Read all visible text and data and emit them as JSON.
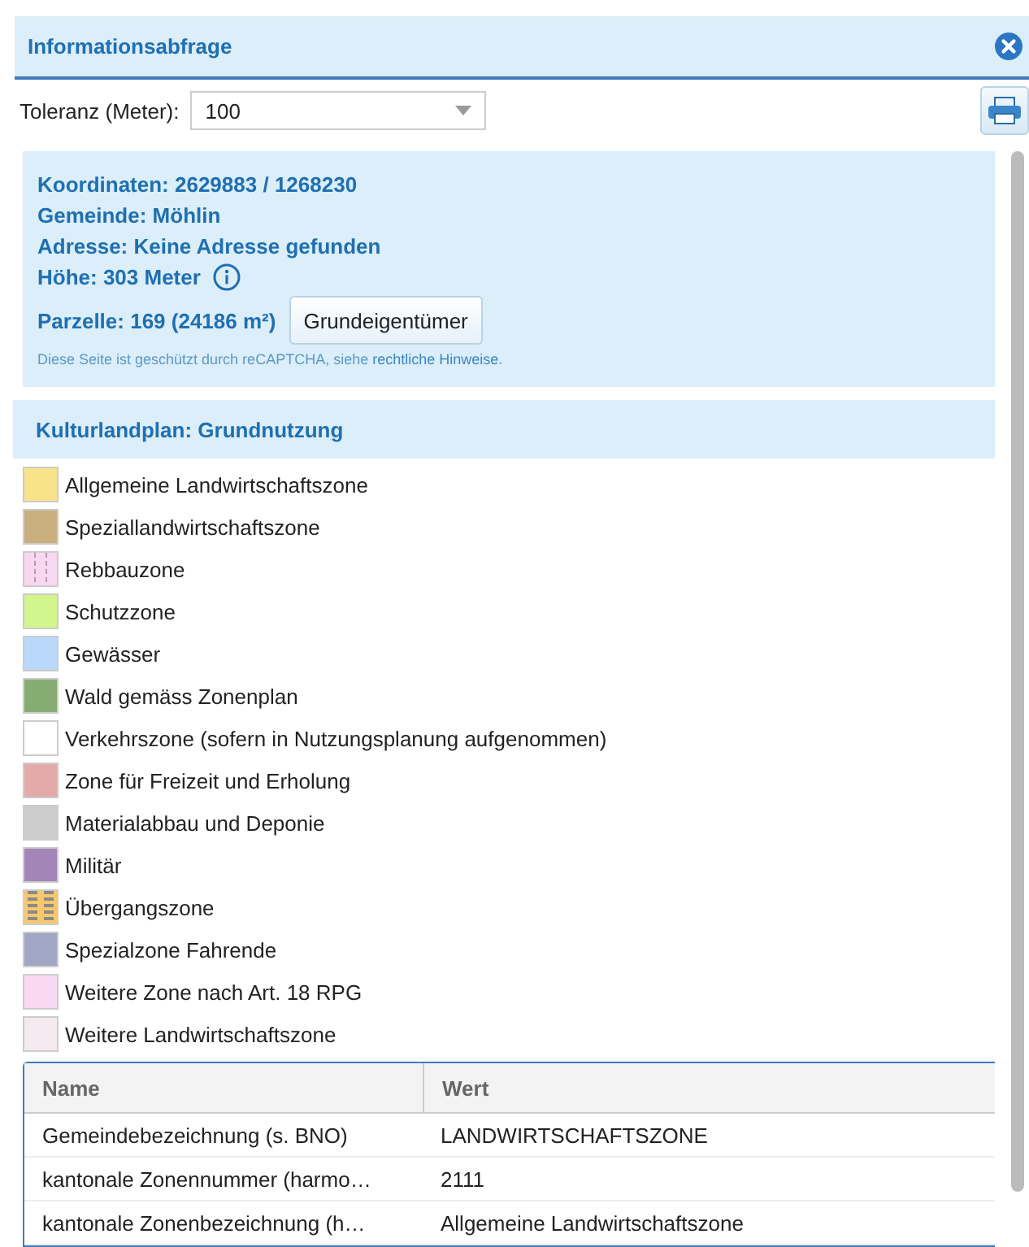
{
  "window": {
    "title": "Informationsabfrage"
  },
  "tolerance": {
    "label": "Toleranz (Meter):",
    "value": "100"
  },
  "info": {
    "lines": [
      {
        "kind": "text",
        "text": "Koordinaten: 2629883 / 1268230"
      },
      {
        "kind": "text",
        "text": "Gemeinde: Möhlin"
      },
      {
        "kind": "text",
        "text": "Adresse: Keine Adresse gefunden"
      },
      {
        "kind": "info",
        "text": "Höhe: 303 Meter"
      },
      {
        "kind": "button",
        "text": "Parzelle: 169 (24186 m²)",
        "button": "Grundeigentümer"
      }
    ],
    "notice": {
      "before": "Diese Seite ist geschützt durch reCAPTCHA, siehe ",
      "link": "rechtliche Hinweise",
      "after": "."
    }
  },
  "section": {
    "title": "Kulturlandplan: Grundnutzung"
  },
  "legend": [
    {
      "label": "Allgemeine Landwirtschaftszone",
      "kind": "solid",
      "color": "#f9e38a"
    },
    {
      "label": "Speziallandwirtschaftszone",
      "kind": "solid",
      "color": "#c9ae7e"
    },
    {
      "label": "Rebbauzone",
      "kind": "vlines",
      "color": "#f8d8f0"
    },
    {
      "label": "Schutzzone",
      "kind": "solid",
      "color": "#d3f58e"
    },
    {
      "label": "Gewässer",
      "kind": "solid",
      "color": "#b9d8fa"
    },
    {
      "label": "Wald gemäss Zonenplan",
      "kind": "solid",
      "color": "#87ac73"
    },
    {
      "label": "Verkehrszone (sofern in Nutzungsplanung aufgenommen)",
      "kind": "solid",
      "color": "#ffffff"
    },
    {
      "label": "Zone für Freizeit und Erholung",
      "kind": "solid",
      "color": "#e4aaaa"
    },
    {
      "label": "Materialabbau und Deponie",
      "kind": "solid",
      "color": "#cccccc"
    },
    {
      "label": "Militär",
      "kind": "solid",
      "color": "#a385b7"
    },
    {
      "label": "Übergangszone",
      "kind": "stripes",
      "color": "#f9c86b"
    },
    {
      "label": "Spezialzone Fahrende",
      "kind": "solid",
      "color": "#a0a6c4"
    },
    {
      "label": "Weitere Zone nach Art. 18 RPG",
      "kind": "solid",
      "color": "#f9d9f2"
    },
    {
      "label": "Weitere Landwirtschaftszone",
      "kind": "solid",
      "color": "#f3e9ef"
    }
  ],
  "table": {
    "columns": [
      "Name",
      "Wert"
    ],
    "rows": [
      [
        "Gemeindebezeichnung (s. BNO)",
        "LANDWIRTSCHAFTSZONE"
      ],
      [
        "kantonale Zonennummer (harmo…",
        "2111"
      ],
      [
        "kantonale Zonenbezeichnung (h…",
        "Allgemeine Landwirtschaftszone"
      ]
    ]
  }
}
